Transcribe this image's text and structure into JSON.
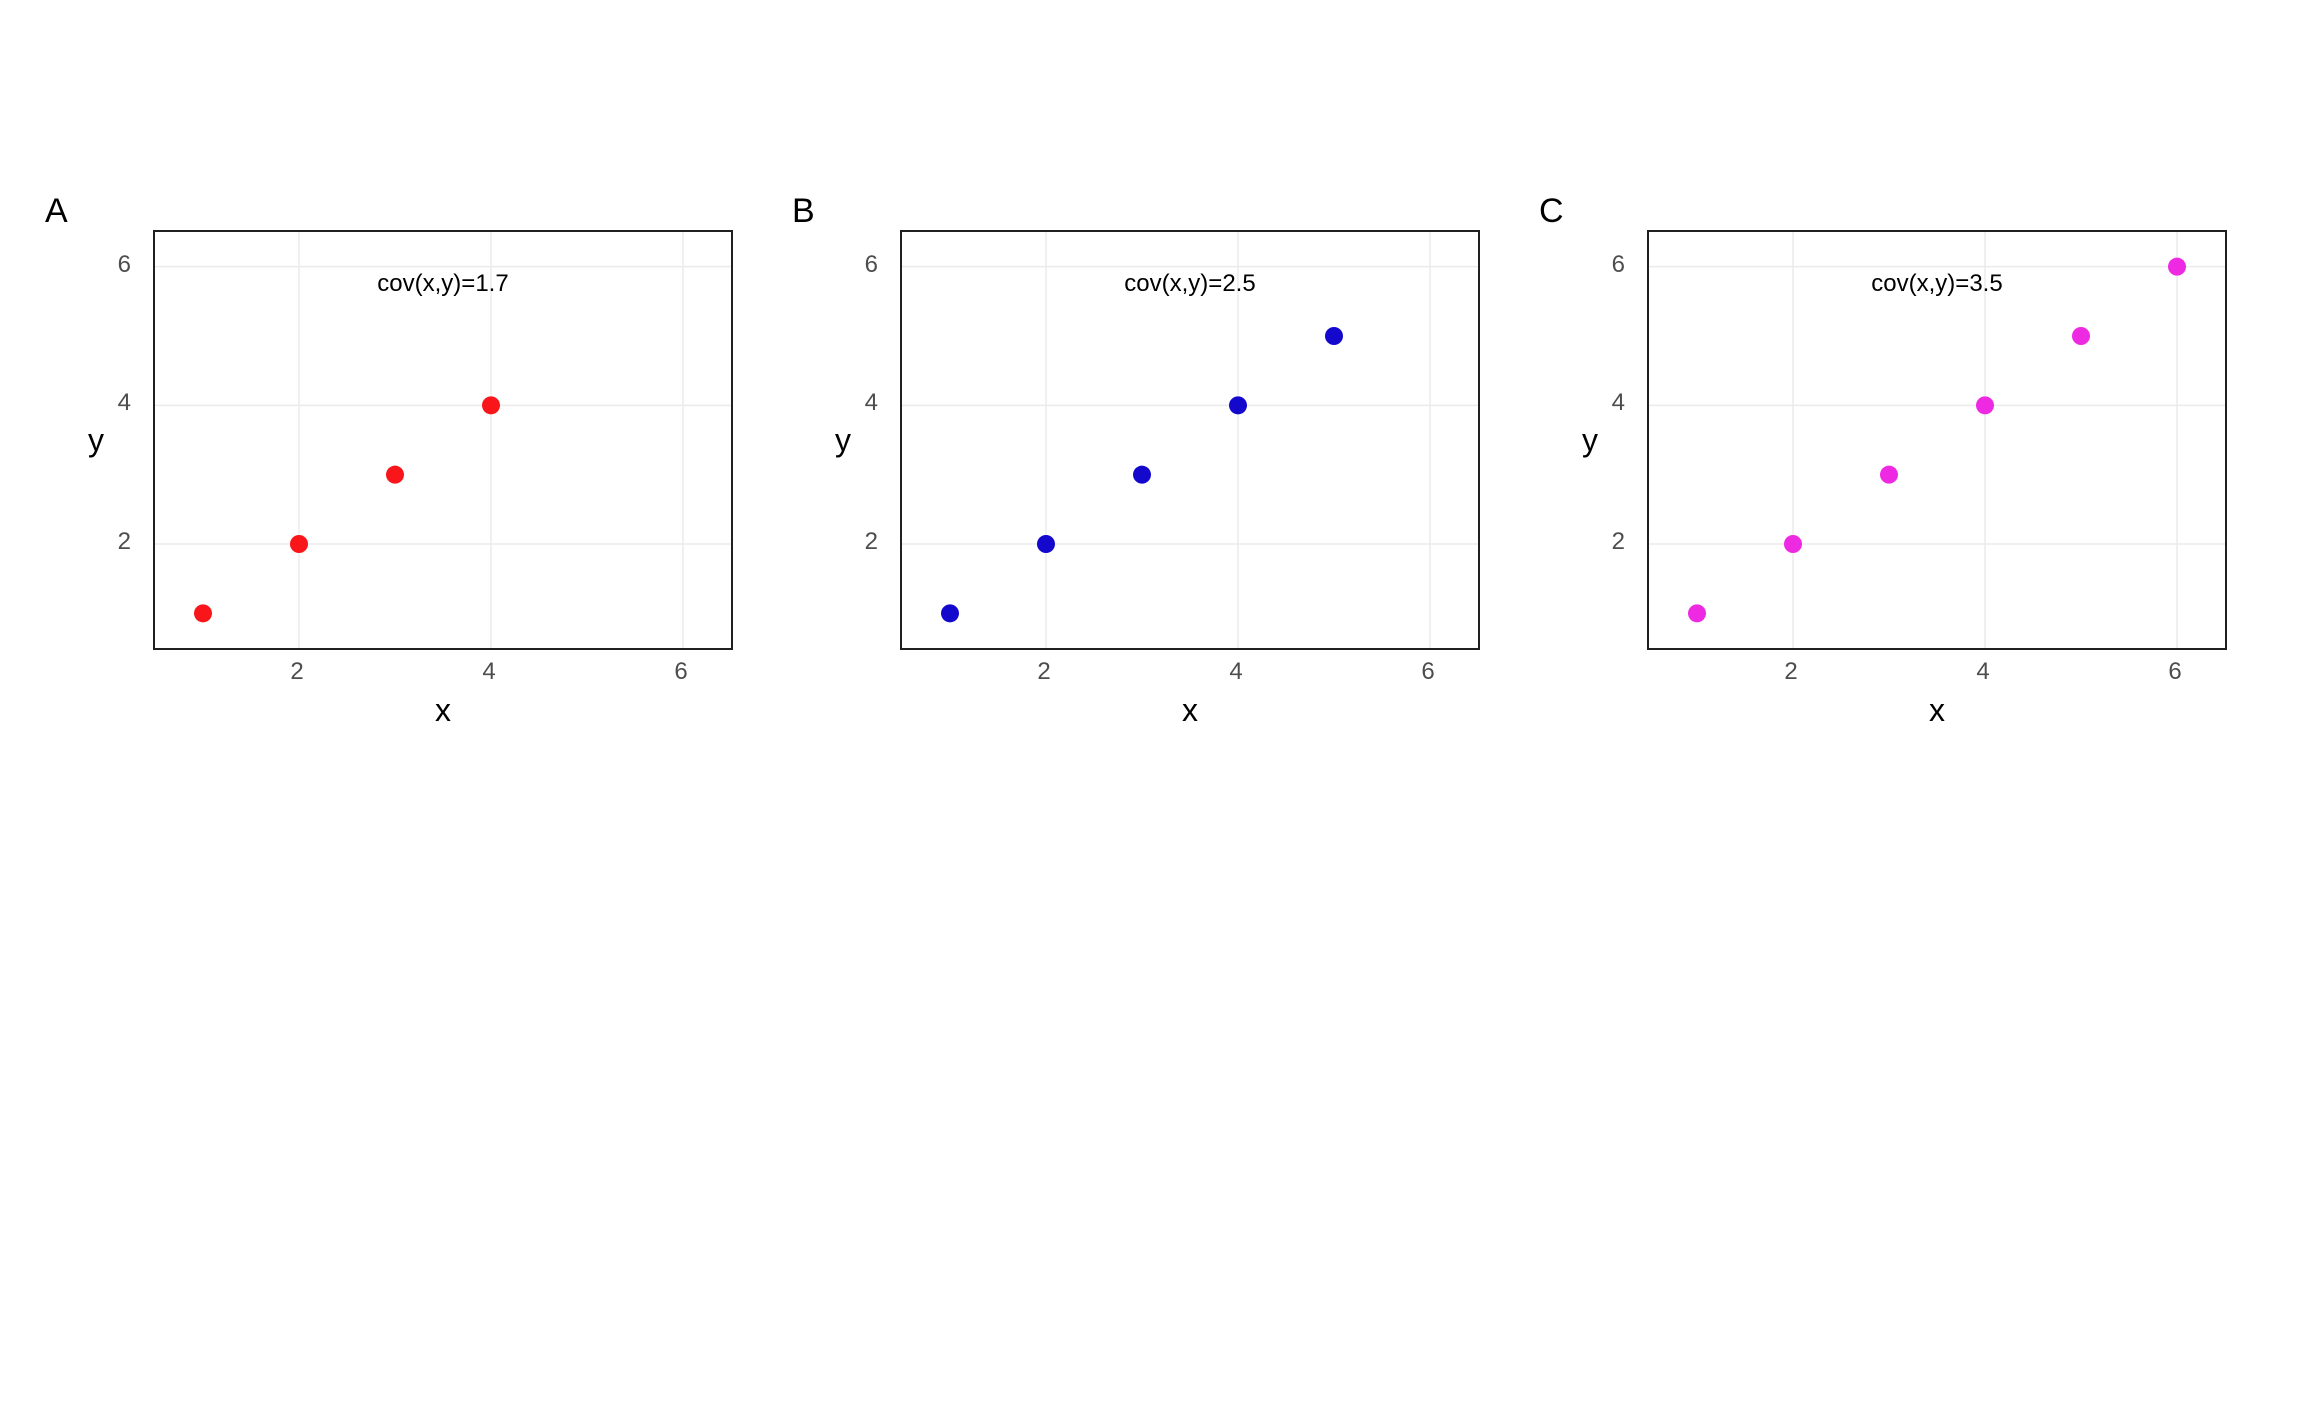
{
  "chart_data": [
    {
      "type": "scatter",
      "panel_label": "A",
      "annotation": "cov(x,y)=1.7",
      "xlabel": "x",
      "ylabel": "y",
      "xlim": [
        0.5,
        6.5
      ],
      "ylim": [
        0.5,
        6.5
      ],
      "xticks": [
        2,
        4,
        6
      ],
      "yticks": [
        2,
        4,
        6
      ],
      "color": "#f8161a",
      "points": [
        {
          "x": 1,
          "y": 1
        },
        {
          "x": 2,
          "y": 2
        },
        {
          "x": 3,
          "y": 3
        },
        {
          "x": 4,
          "y": 4
        }
      ]
    },
    {
      "type": "scatter",
      "panel_label": "B",
      "annotation": "cov(x,y)=2.5",
      "xlabel": "x",
      "ylabel": "y",
      "xlim": [
        0.5,
        6.5
      ],
      "ylim": [
        0.5,
        6.5
      ],
      "xticks": [
        2,
        4,
        6
      ],
      "yticks": [
        2,
        4,
        6
      ],
      "color": "#1408cc",
      "points": [
        {
          "x": 1,
          "y": 1
        },
        {
          "x": 2,
          "y": 2
        },
        {
          "x": 3,
          "y": 3
        },
        {
          "x": 4,
          "y": 4
        },
        {
          "x": 5,
          "y": 5
        }
      ]
    },
    {
      "type": "scatter",
      "panel_label": "C",
      "annotation": "cov(x,y)=3.5",
      "xlabel": "x",
      "ylabel": "y",
      "xlim": [
        0.5,
        6.5
      ],
      "ylim": [
        0.5,
        6.5
      ],
      "xticks": [
        2,
        4,
        6
      ],
      "yticks": [
        2,
        4,
        6
      ],
      "color": "#ee29e2",
      "points": [
        {
          "x": 1,
          "y": 1
        },
        {
          "x": 2,
          "y": 2
        },
        {
          "x": 3,
          "y": 3
        },
        {
          "x": 4,
          "y": 4
        },
        {
          "x": 5,
          "y": 5
        },
        {
          "x": 6,
          "y": 6
        }
      ]
    }
  ]
}
